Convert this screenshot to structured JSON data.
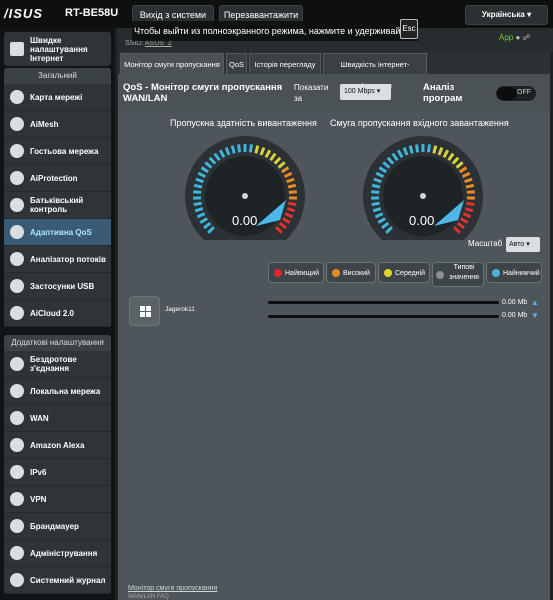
{
  "header": {
    "logo": "/ISUS",
    "model": "RT-BE58U",
    "logout_label": "Вихід з системи",
    "reboot_label": "Перезавантажити",
    "language": "Українська",
    "toast_text": "Чтобы выйти из полноэкранного режима, нажмите и удерживайте",
    "esc_label": "Esc",
    "ssid_label": "SSID:",
    "ssid_value": "ASUS_2",
    "app_label": "App"
  },
  "sidebar": {
    "quick_setup": "Швидке налаштування Інтернет",
    "general_title": "Загальний",
    "general_items": [
      {
        "label": "Карта мережі",
        "icon": "network-map-icon"
      },
      {
        "label": "AiMesh",
        "icon": "aimesh-icon"
      },
      {
        "label": "Гостьова мережа",
        "icon": "guest-network-icon"
      },
      {
        "label": "AiProtection",
        "icon": "shield-icon"
      },
      {
        "label": "Батьківський контроль",
        "icon": "parental-control-icon"
      },
      {
        "label": "Адаптивна QoS",
        "icon": "qos-gauge-icon"
      },
      {
        "label": "Аналізатор потоків",
        "icon": "traffic-analyzer-icon"
      },
      {
        "label": "Застосунки USB",
        "icon": "usb-icon"
      },
      {
        "label": "AiCloud 2.0",
        "icon": "cloud-icon"
      }
    ],
    "advanced_title": "Додаткові налаштування",
    "advanced_items": [
      {
        "label": "Бездротове з'єднання",
        "icon": "wireless-icon"
      },
      {
        "label": "Локальна мережа",
        "icon": "lan-icon"
      },
      {
        "label": "WAN",
        "icon": "globe-icon"
      },
      {
        "label": "Amazon Alexa",
        "icon": "alexa-icon"
      },
      {
        "label": "IPv6",
        "icon": "ipv6-icon"
      },
      {
        "label": "VPN",
        "icon": "vpn-icon"
      },
      {
        "label": "Брандмауер",
        "icon": "firewall-icon"
      },
      {
        "label": "Адміністрування",
        "icon": "admin-icon"
      },
      {
        "label": "Системний журнал",
        "icon": "system-log-icon"
      }
    ]
  },
  "tabs": [
    "Монітор смуги пропускання",
    "QoS",
    "Історія перегляду",
    "Швидкість інтернет-з'єднання"
  ],
  "main": {
    "title": "QoS - Монітор смуги пропускання WAN/LAN",
    "show_label": "Показати за",
    "show_value": "100 Mbps",
    "analysis_label": "Аналіз програм",
    "toggle_value": "OFF",
    "upload_title": "Пропускна здатність вивантаження",
    "download_title": "Смуга пропускання вхідного завантаження",
    "upload_value": "0.00",
    "download_value": "0.00",
    "upload_level": 0,
    "download_level": 0,
    "scale_label": "Масштаб",
    "scale_value": "Авто",
    "legend": [
      {
        "label": "Найвищий",
        "color": "#e0262c"
      },
      {
        "label": "Високий",
        "color": "#e98a1e"
      },
      {
        "label": "Середній",
        "color": "#e3d22a"
      },
      {
        "label": "Типові значення",
        "color": "#8a8f92"
      },
      {
        "label": "Найнижчий",
        "color": "#4bb3e0"
      }
    ],
    "device_name": "Jagerok11",
    "upload_rate": "0.00 Mb",
    "download_rate": "0.00 Mb",
    "footer_link": "Монітор смуги пропускання",
    "footer_sub": "WAN/LAN FAQ"
  }
}
